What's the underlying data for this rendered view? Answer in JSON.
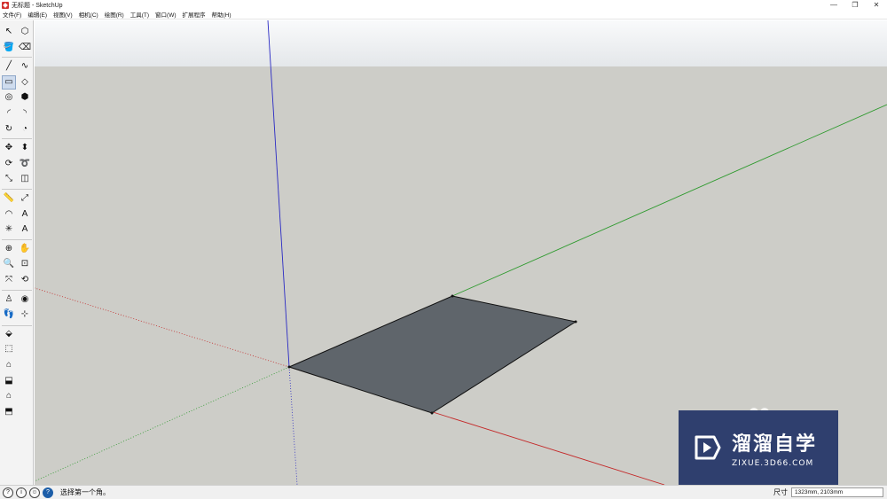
{
  "window": {
    "title": "无标题 - SketchUp",
    "minimize_glyph": "—",
    "restore_glyph": "❐",
    "close_glyph": "✕"
  },
  "menu": [
    "文件(F)",
    "编辑(E)",
    "视图(V)",
    "相机(C)",
    "绘图(R)",
    "工具(T)",
    "窗口(W)",
    "扩展程序",
    "帮助(H)"
  ],
  "toolbar": {
    "tools": [
      {
        "name": "select-tool-icon",
        "glyph": "↖"
      },
      {
        "name": "make-component-icon",
        "glyph": "⬡"
      },
      {
        "name": "paint-bucket-icon",
        "glyph": "🪣"
      },
      {
        "name": "eraser-icon",
        "glyph": "⌫"
      },
      {
        "name": "line-tool-icon",
        "glyph": "╱"
      },
      {
        "name": "freehand-tool-icon",
        "glyph": "∿"
      },
      {
        "name": "rectangle-tool-icon",
        "glyph": "▭"
      },
      {
        "name": "rotated-rectangle-icon",
        "glyph": "◇"
      },
      {
        "name": "circle-tool-icon",
        "glyph": "◎"
      },
      {
        "name": "polygon-tool-icon",
        "glyph": "⬢"
      },
      {
        "name": "arc-tool-icon",
        "glyph": "◜"
      },
      {
        "name": "two-point-arc-icon",
        "glyph": "◝"
      },
      {
        "name": "three-point-arc-icon",
        "glyph": "↻"
      },
      {
        "name": "pie-tool-icon",
        "glyph": "◔"
      },
      {
        "name": "move-tool-icon",
        "glyph": "✥"
      },
      {
        "name": "push-pull-icon",
        "glyph": "⬍"
      },
      {
        "name": "rotate-tool-icon",
        "glyph": "⟳"
      },
      {
        "name": "follow-me-icon",
        "glyph": "➰"
      },
      {
        "name": "scale-tool-icon",
        "glyph": "⤡"
      },
      {
        "name": "offset-tool-icon",
        "glyph": "◫"
      },
      {
        "name": "tape-measure-icon",
        "glyph": "📏"
      },
      {
        "name": "dimension-tool-icon",
        "glyph": "⤢"
      },
      {
        "name": "protractor-icon",
        "glyph": "◠"
      },
      {
        "name": "text-tool-icon",
        "glyph": "A"
      },
      {
        "name": "axes-tool-icon",
        "glyph": "✳"
      },
      {
        "name": "3d-text-icon",
        "glyph": "A"
      },
      {
        "name": "orbit-tool-icon",
        "glyph": "⊕"
      },
      {
        "name": "pan-tool-icon",
        "glyph": "✋"
      },
      {
        "name": "zoom-tool-icon",
        "glyph": "🔍"
      },
      {
        "name": "zoom-window-icon",
        "glyph": "⊡"
      },
      {
        "name": "zoom-extents-icon",
        "glyph": "⤧"
      },
      {
        "name": "previous-view-icon",
        "glyph": "⟲"
      },
      {
        "name": "position-camera-icon",
        "glyph": "♙"
      },
      {
        "name": "look-around-icon",
        "glyph": "◉"
      },
      {
        "name": "walk-tool-icon",
        "glyph": "👣"
      },
      {
        "name": "section-plane-icon",
        "glyph": "⊹"
      }
    ],
    "views": [
      {
        "name": "iso-view-icon",
        "glyph": "⬙"
      },
      {
        "name": "top-view-icon",
        "glyph": "⬚"
      },
      {
        "name": "front-view-icon",
        "glyph": "⌂"
      },
      {
        "name": "right-view-icon",
        "glyph": "⬓"
      },
      {
        "name": "back-view-icon",
        "glyph": "⌂"
      },
      {
        "name": "left-view-icon",
        "glyph": "⬒"
      }
    ]
  },
  "colors": {
    "x_axis": "#c42a2a",
    "y_axis": "#2e9a2e",
    "z_axis": "#2a2ac4",
    "face": "#5f656b",
    "sky_top": "#f9fafb",
    "ground": "#cdcdc8",
    "watermark_bg": "#2f3f6e"
  },
  "watermark": {
    "title": "溜溜自学",
    "subtitle": "ZIXUE.3D66.COM"
  },
  "status": {
    "message": "选择第一个角。",
    "measure_label": "尺寸",
    "measure_value": "1323mm, 2103mm"
  }
}
